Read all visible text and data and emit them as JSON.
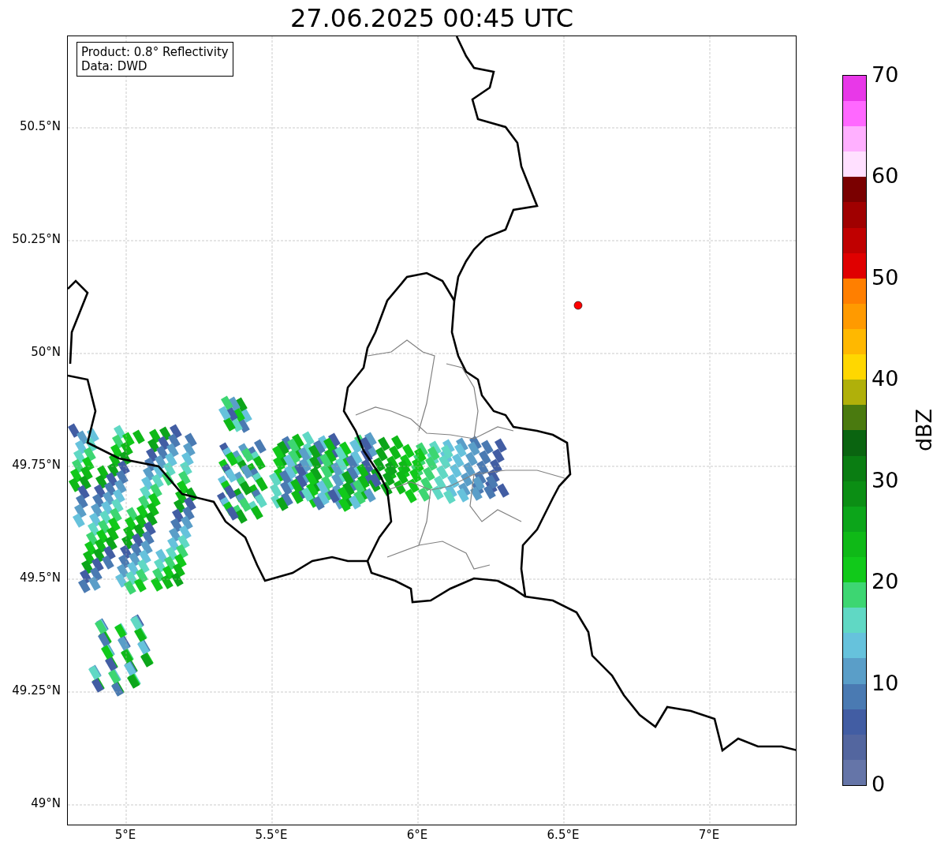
{
  "title": "27.06.2025 00:45 UTC",
  "info_box": [
    "Product: 0.8° Reflectivity",
    "Data: DWD"
  ],
  "map": {
    "y_ticks": [
      "50.5°N",
      "50.25°N",
      "50°N",
      "49.75°N",
      "49.5°N",
      "49.25°N",
      "49°N"
    ],
    "x_ticks": [
      "5°E",
      "5.5°E",
      "6°E",
      "6.5°E",
      "7°E"
    ]
  },
  "colorbar": {
    "label": "dBZ",
    "ticks": [
      "70",
      "60",
      "50",
      "40",
      "30",
      "20",
      "10",
      "0"
    ],
    "bins": [
      {
        "color": "#6575a8"
      },
      {
        "color": "#53669f"
      },
      {
        "color": "#425da3"
      },
      {
        "color": "#4a7ab2"
      },
      {
        "color": "#5a9ec8"
      },
      {
        "color": "#66c2dc"
      },
      {
        "color": "#60d8c4"
      },
      {
        "color": "#3dd672"
      },
      {
        "color": "#11c91a"
      },
      {
        "color": "#0fb917"
      },
      {
        "color": "#0ca51a"
      },
      {
        "color": "#0b8e14"
      },
      {
        "color": "#0a7d12"
      },
      {
        "color": "#0a6410"
      },
      {
        "color": "#4a7a0f"
      },
      {
        "color": "#b0b00a"
      },
      {
        "color": "#ffd700"
      },
      {
        "color": "#ffb800"
      },
      {
        "color": "#ff9a00"
      },
      {
        "color": "#ff7f00"
      },
      {
        "color": "#e00000"
      },
      {
        "color": "#c00000"
      },
      {
        "color": "#a00000"
      },
      {
        "color": "#7a0000"
      },
      {
        "color": "#ffe0ff"
      },
      {
        "color": "#ffb0ff"
      },
      {
        "color": "#ff68ff"
      },
      {
        "color": "#e838e8"
      }
    ]
  }
}
